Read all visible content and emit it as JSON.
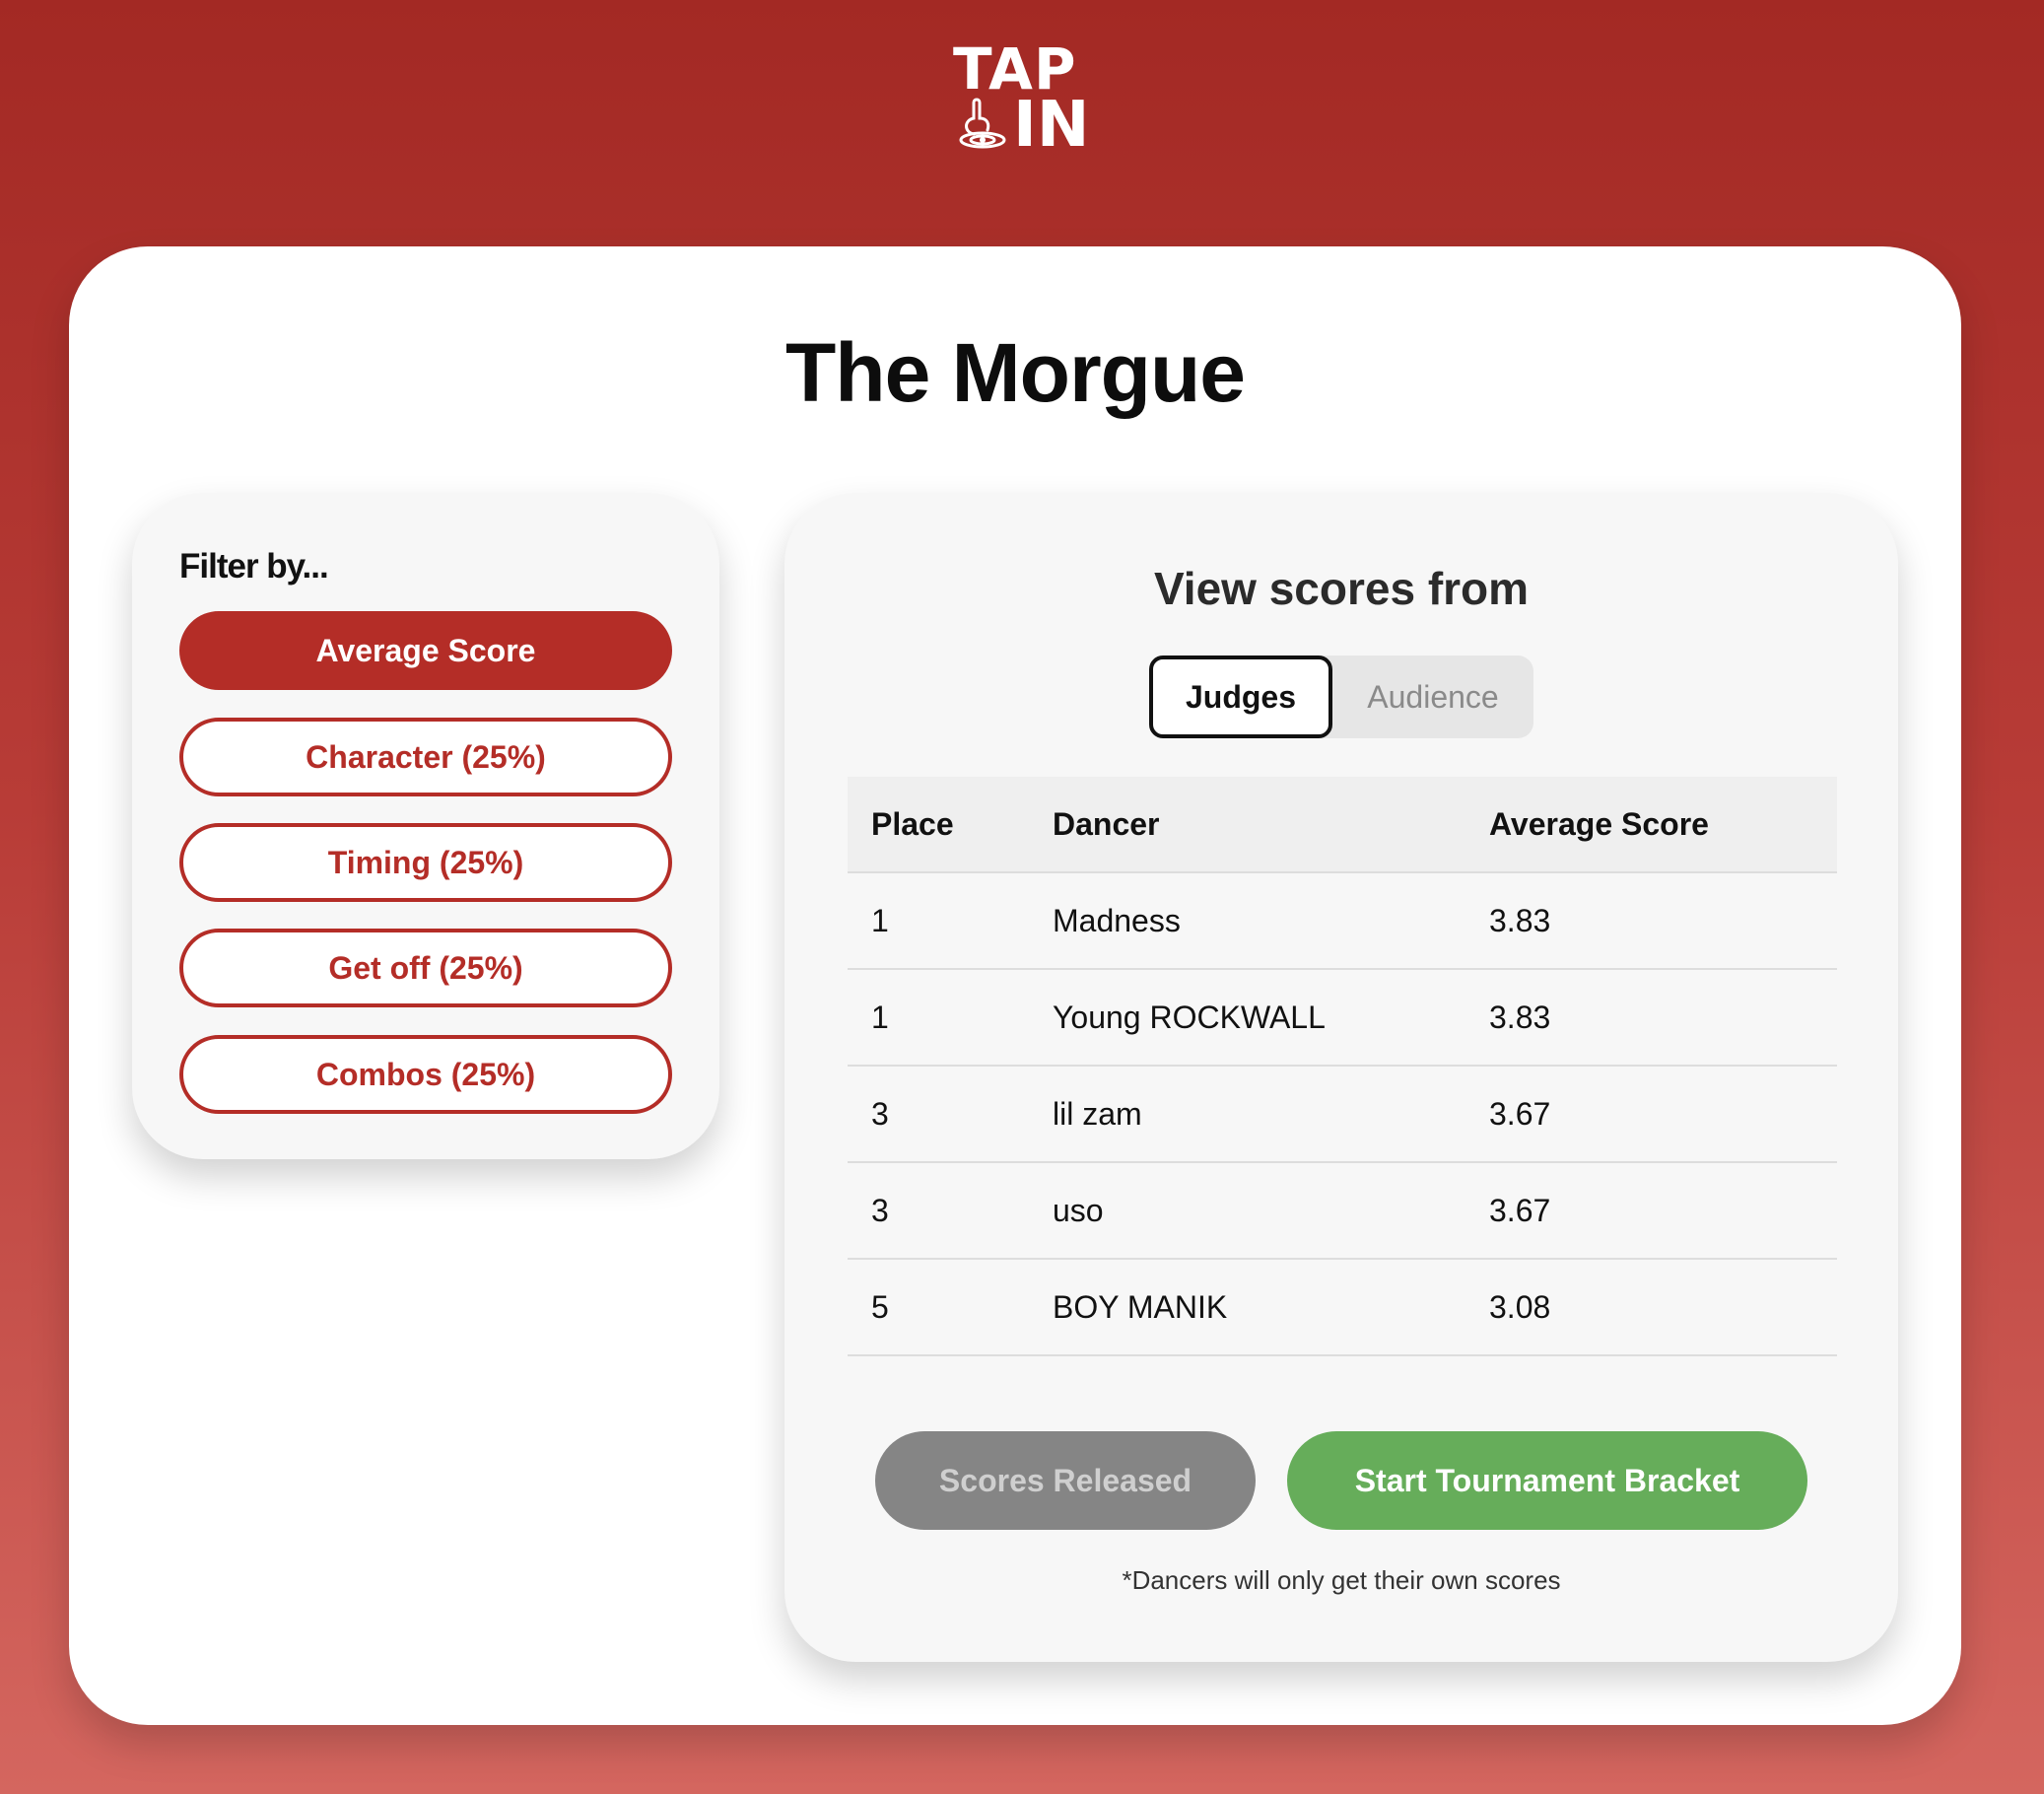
{
  "logo": {
    "line1": "TAP",
    "line2": "IN",
    "icon": "tap-finger-icon"
  },
  "title": "The Morgue",
  "filter": {
    "label": "Filter by...",
    "options": [
      {
        "label": "Average Score",
        "active": true
      },
      {
        "label": "Character (25%)",
        "active": false
      },
      {
        "label": "Timing (25%)",
        "active": false
      },
      {
        "label": "Get off (25%)",
        "active": false
      },
      {
        "label": "Combos (25%)",
        "active": false
      }
    ]
  },
  "scores": {
    "heading": "View scores from",
    "toggle": {
      "judges": "Judges",
      "audience": "Audience",
      "selected": "Judges"
    },
    "columns": {
      "place": "Place",
      "dancer": "Dancer",
      "score": "Average Score"
    },
    "rows": [
      {
        "place": "1",
        "dancer": "Madness",
        "score": "3.83"
      },
      {
        "place": "1",
        "dancer": "Young ROCKWALL",
        "score": "3.83"
      },
      {
        "place": "3",
        "dancer": "lil zam",
        "score": "3.67"
      },
      {
        "place": "3",
        "dancer": "uso",
        "score": "3.67"
      },
      {
        "place": "5",
        "dancer": "BOY MANIK",
        "score": "3.08"
      }
    ],
    "released_label": "Scores Released",
    "bracket_label": "Start Tournament Bracket",
    "note": "*Dancers will only get their own scores"
  },
  "colors": {
    "brand": "#b42d27",
    "success": "#66ad5a",
    "disabled": "#858585"
  }
}
